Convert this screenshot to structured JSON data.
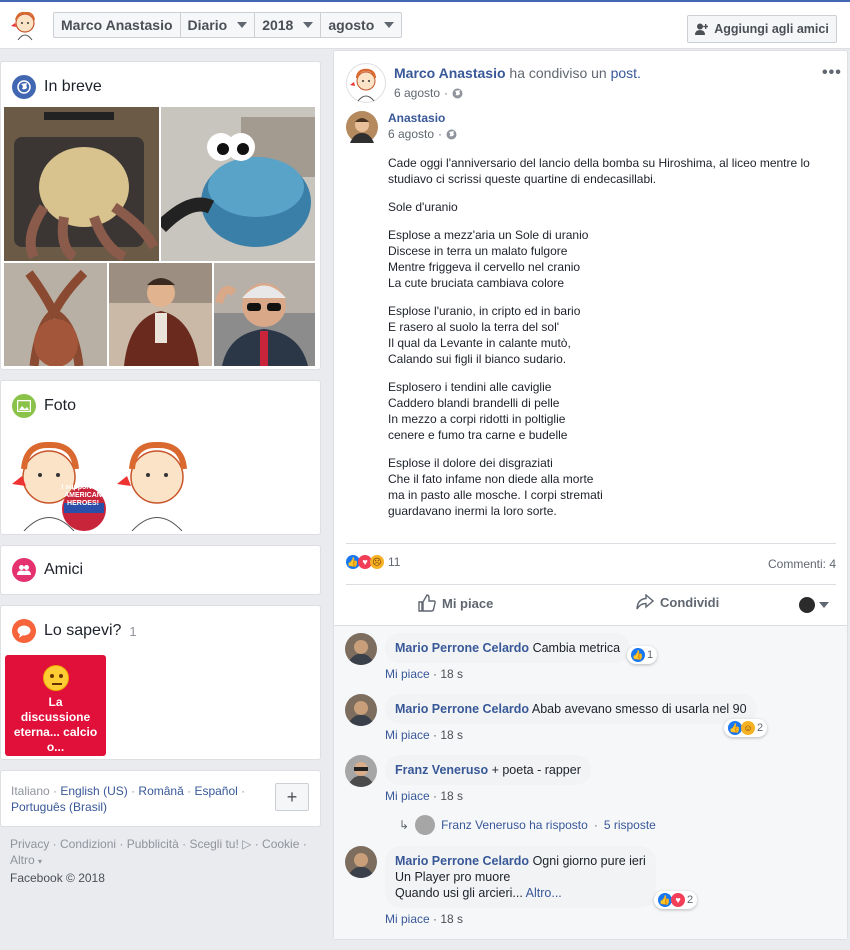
{
  "topbar": {
    "profile_name": "Marco Anastasio",
    "crumb_diario": "Diario",
    "crumb_year": "2018",
    "crumb_month": "agosto",
    "add_friend": "Aggiungi agli amici"
  },
  "sidebar": {
    "in_breve": "In breve",
    "foto": "Foto",
    "amici": "Amici",
    "lo_sapevi": "Lo sapevi?",
    "lo_sapevi_count": "1",
    "lo_sapevi_card": "La discussione eterna... calcio o...",
    "languages": [
      "Italiano",
      "English (US)",
      "Română",
      "Español",
      "Português (Brasil)"
    ],
    "footer_links": [
      "Privacy",
      "Condizioni",
      "Pubblicità",
      "Scegli tu!",
      "Cookie",
      "Altro"
    ],
    "copyright": "Facebook © 2018",
    "badge_text": "I support our AMERICAN HEROES!"
  },
  "post": {
    "author": "Marco Anastasio",
    "shared_text": "ha condiviso un",
    "shared_link": "post.",
    "date": "6 agosto",
    "orig_author": "Anastasio",
    "orig_date": "6 agosto",
    "paragraphs": [
      "Cade oggi l'anniversario del lancio della bomba su Hiroshima, al liceo mentre lo studiavo ci scrissi queste quartine di endecasillabi.",
      "Sole d'uranio",
      "Esplose a mezz'aria un Sole di uranio\nDiscese in terra un malato fulgore\nMentre friggeva il cervello nel cranio\nLa cute bruciata cambiava colore",
      "Esplose l'uranio, in cripto ed in bario\nE rasero al suolo la terra del sol'\nIl qual da Levante in calante mutò,\nCalando sui figli il bianco sudario.",
      "Esplosero i tendini alle caviglie\nCaddero blandi brandelli di pelle\nIn mezzo a corpi ridotti in poltiglie\ncenere e fumo tra carne e budelle",
      "Esplose il dolore dei disgraziati\nChe il fato infame non diede alla morte\nma in pasto alle mosche. I corpi stremati\nguardavano inermi la loro sorte."
    ],
    "reactions_count": "11",
    "comments_count": "Commenti: 4",
    "like_label": "Mi piace",
    "share_label": "Condividi",
    "comments": [
      {
        "name": "Mario Perrone Celardo",
        "text": "Cambia metrica",
        "like": "Mi piace",
        "time": "18 s",
        "rx_count": "1"
      },
      {
        "name": "Mario Perrone Celardo",
        "text": "Abab avevano smesso di usarla nel 90",
        "like": "Mi piace",
        "time": "18 s",
        "rx_count": "2"
      },
      {
        "name": "Franz Veneruso",
        "text": "+ poeta - rapper",
        "like": "Mi piace",
        "time": "18 s",
        "reply_author": "Franz Veneruso ha risposto",
        "reply_count": "5 risposte"
      },
      {
        "name": "Mario Perrone Celardo",
        "text": "Ogni giorno pure ieri",
        "line2": "Un Player pro muore",
        "line3": "Quando usi gli arcieri...",
        "more": "Altro...",
        "like": "Mi piace",
        "time": "18 s",
        "rx_count": "2"
      }
    ]
  },
  "colors": {
    "fb_blue": "#4267b2",
    "link": "#385898",
    "like": "#1877f2",
    "love": "#f33e58",
    "lo_sapevi_bg": "#e0103a"
  }
}
